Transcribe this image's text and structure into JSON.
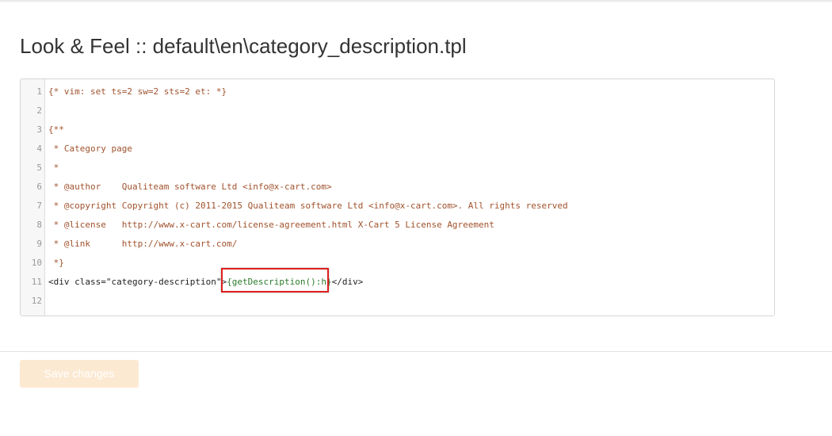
{
  "page": {
    "title": "Look & Feel :: default\\en\\category_description.tpl"
  },
  "editor": {
    "lines": [
      {
        "number": "1",
        "segments": [
          {
            "text": "{* vim: set ts=2 sw=2 sts=2 et: *}",
            "kind": "comment"
          }
        ]
      },
      {
        "number": "2",
        "segments": []
      },
      {
        "number": "3",
        "segments": [
          {
            "text": "{**",
            "kind": "comment"
          }
        ]
      },
      {
        "number": "4",
        "segments": [
          {
            "text": " * Category page",
            "kind": "comment"
          }
        ]
      },
      {
        "number": "5",
        "segments": [
          {
            "text": " *",
            "kind": "comment"
          }
        ]
      },
      {
        "number": "6",
        "segments": [
          {
            "text": " * @author    Qualiteam software Ltd <info@x-cart.com>",
            "kind": "comment"
          }
        ]
      },
      {
        "number": "7",
        "segments": [
          {
            "text": " * @copyright Copyright (c) 2011-2015 Qualiteam software Ltd <info@x-cart.com>. All rights reserved",
            "kind": "comment"
          }
        ]
      },
      {
        "number": "8",
        "segments": [
          {
            "text": " * @license   http://www.x-cart.com/license-agreement.html X-Cart 5 License Agreement",
            "kind": "comment"
          }
        ]
      },
      {
        "number": "9",
        "segments": [
          {
            "text": " * @link      http://www.x-cart.com/",
            "kind": "comment"
          }
        ]
      },
      {
        "number": "10",
        "segments": [
          {
            "text": " *}",
            "kind": "comment"
          }
        ]
      },
      {
        "number": "11",
        "segments": [
          {
            "text": "<div class=\"category-description\">",
            "kind": "html"
          },
          {
            "text": "{getDescription():h}",
            "kind": "smarty"
          },
          {
            "text": "</div>",
            "kind": "html"
          }
        ]
      },
      {
        "number": "12",
        "segments": []
      }
    ]
  },
  "footer": {
    "save_label": "Save changes"
  },
  "colors": {
    "comment": "#a0522d",
    "html": "#222222",
    "smarty": "#2a7a2a",
    "highlight_border": "#dd1f1f",
    "save_button_bg": "#fce9d2"
  }
}
